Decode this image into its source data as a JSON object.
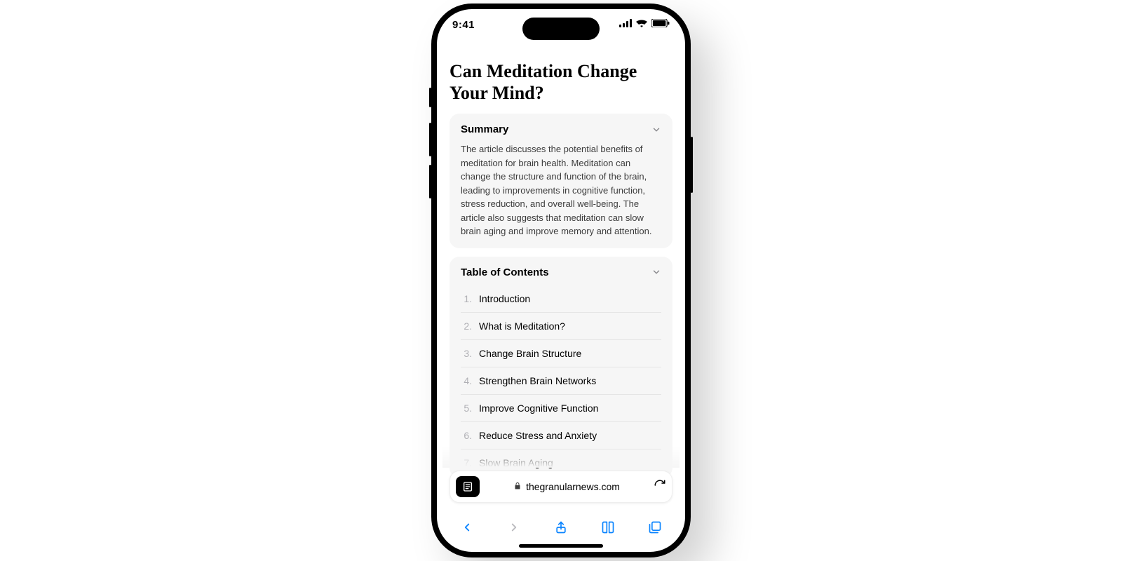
{
  "status": {
    "time": "9:41"
  },
  "article": {
    "title": "Can Meditation Change Your Mind?",
    "summary_label": "Summary",
    "summary_text": "The article discusses the potential benefits of meditation for brain health. Meditation can change the structure and function of the brain, leading to improvements in cognitive function, stress reduction, and overall well-being. The article also suggests that meditation can slow brain aging and improve memory and attention.",
    "toc_label": "Table of Contents",
    "toc": [
      "Introduction",
      "What is Meditation?",
      "Change Brain Structure",
      "Strengthen Brain Networks",
      "Improve Cognitive Function",
      "Reduce Stress and Anxiety",
      "Slow Brain Aging"
    ]
  },
  "browser": {
    "domain": "thegranularnews.com"
  }
}
